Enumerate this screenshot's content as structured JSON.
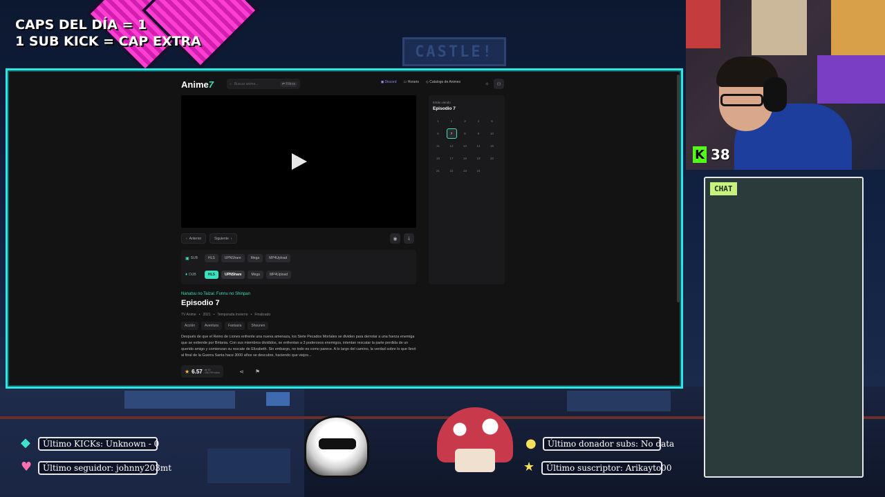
{
  "overlay": {
    "caps_line1": "CAPS DEL DÍA = 1",
    "caps_line2": "1 SUB KICK = CAP EXTRA",
    "castle_sign": "CASTLE!",
    "kick_viewers": "38",
    "chat_label": "CHAT",
    "alerts": {
      "kicks": "Último KICKs: Unknown - 0",
      "follower": "Último seguidor: johnny203mt",
      "donor": "Último donador subs: No data",
      "subscriber": "Último suscriptor: Arikayto00"
    },
    "colors": {
      "frame": "#2ee6e6",
      "accent": "#3be0bd",
      "kick": "#53fc18",
      "chat_tag": "#c6f27d"
    }
  },
  "site": {
    "logo_text": "Anime",
    "logo_suffix": "7",
    "search_placeholder": "Buscar anime...",
    "filter_label": "Filtros",
    "nav": [
      "Discord",
      "Horario",
      "Catalogo de Animes"
    ],
    "prev_label": "Anterior",
    "next_label": "Siguiente",
    "servers": {
      "sub_label": "SUB",
      "dub_label": "DUB",
      "sub": [
        "HLS",
        "UPNShare",
        "Mega",
        "MP4Upload"
      ],
      "dub": [
        "HLS",
        "UPNShare",
        "Mega",
        "MP4Upload"
      ]
    },
    "series_title": "Nanatsu no Taizai: Funnu no Shinpan",
    "episode_title": "Episodio 7",
    "meta": [
      "TV Anime",
      "•",
      "2021",
      "•",
      "Temporada Invierno",
      "•",
      "Finalizado"
    ],
    "genres": [
      "Acción",
      "Aventura",
      "Fantasía",
      "Shounen"
    ],
    "synopsis": "Después de que el Reino de Liones enfrente una nueva amenaza, los Siete Pecados Mortales se dividen para derrotar a una fuerza enemiga que se extiende por Britania. Con sus miembros divididos, se enfrentan a 3 poderosos enemigos, intentan rescatar la parte perdida de un querido amigo y comienzan su rescate de Elizabeth. Sin embargo, no todo es como parece. A lo largo del camino, la verdad sobre lo que llevó al final de la Guerra Santa hace 3000 años se descubre, haciendo que viejos...",
    "rating": "6.57",
    "rating_votes_label": "de 10",
    "rating_votes": "236,799",
    "rating_votes_suffix": "votos",
    "watching_label": "Estás viendo",
    "current_episode": "Episodio 7",
    "episodes": [
      "1",
      "2",
      "3",
      "4",
      "5",
      "6",
      "7",
      "8",
      "9",
      "10",
      "11",
      "12",
      "13",
      "14",
      "15",
      "16",
      "17",
      "18",
      "19",
      "20",
      "21",
      "22",
      "23",
      "24"
    ],
    "active_episode": "7",
    "icons": [
      "search-icon",
      "filter-icon",
      "discord-icon",
      "calendar-icon",
      "catalog-icon",
      "sun-icon",
      "user-icon",
      "play-icon",
      "chevron-left-icon",
      "chevron-right-icon",
      "eye-icon",
      "download-icon",
      "monitor-icon",
      "mic-icon",
      "star-icon",
      "share-icon",
      "flag-icon"
    ]
  }
}
